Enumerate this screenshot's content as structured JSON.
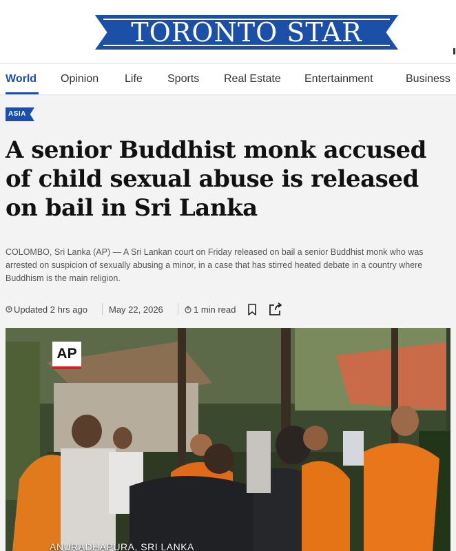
{
  "masthead": {
    "logo_text": "TORONTO STAR",
    "brand_color": "#1b4fa8"
  },
  "nav": {
    "items": [
      {
        "label": "World",
        "active": true
      },
      {
        "label": "Opinion"
      },
      {
        "label": "Life"
      },
      {
        "label": "Sports"
      },
      {
        "label": "Real Estate"
      },
      {
        "label": "Entertainment"
      },
      {
        "label": "Business"
      }
    ]
  },
  "article": {
    "section_tag": "ASIA",
    "headline": "A senior Buddhist monk accused of child sexual abuse is released on bail in Sri Lanka",
    "summary": "COLOMBO, Sri Lanka (AP) — A Sri Lankan court on Friday released on bail a senior Buddhist monk who was arrested on suspicion of sexually abusing a minor, in a case that has stirred heated debate in a country where Buddhism is the main religion.",
    "updated": "Updated 2 hrs ago",
    "date": "May 22, 2026",
    "read_time": "1 min read",
    "icons": {
      "updated": "refresh-clock-icon",
      "read_time": "timer-icon",
      "bookmark": "bookmark-icon",
      "share": "share-icon"
    }
  },
  "video": {
    "ap_logo": "AP",
    "caption": "ANURADHAPURA, SRI LANKA"
  }
}
